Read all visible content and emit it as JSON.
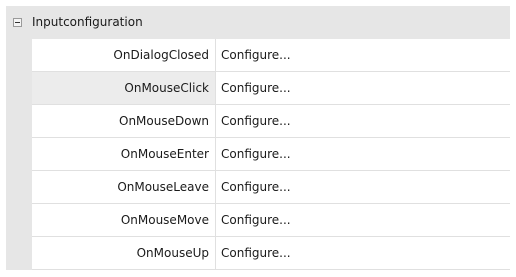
{
  "category": {
    "label": "Inputconfiguration",
    "expanded": true,
    "expander_icon": "collapse-minus-icon"
  },
  "rows": [
    {
      "name": "OnDialogClosed",
      "value": "Configure..."
    },
    {
      "name": "OnMouseClick",
      "value": "Configure...",
      "selected": true
    },
    {
      "name": "OnMouseDown",
      "value": "Configure..."
    },
    {
      "name": "OnMouseEnter",
      "value": "Configure..."
    },
    {
      "name": "OnMouseLeave",
      "value": "Configure..."
    },
    {
      "name": "OnMouseMove",
      "value": "Configure..."
    },
    {
      "name": "OnMouseUp",
      "value": "Configure..."
    }
  ],
  "colors": {
    "category_background": "#e6e6e6",
    "grid_lines": "#e0e0e0",
    "selected_row": "#ececec"
  }
}
